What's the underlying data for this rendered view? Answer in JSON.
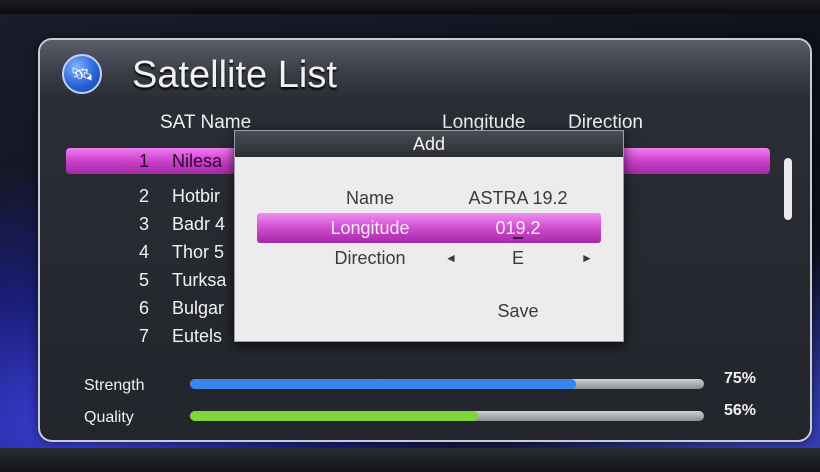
{
  "panel": {
    "title": "Satellite List",
    "icon": "satellite-icon",
    "columns": {
      "name": "SAT Name",
      "longitude": "Longitude",
      "direction": "Direction"
    }
  },
  "satellites": [
    {
      "num": "1",
      "name": "Nilesa",
      "selected": true
    },
    {
      "num": "2",
      "name": "Hotbir"
    },
    {
      "num": "3",
      "name": "Badr 4"
    },
    {
      "num": "4",
      "name": "Thor 5"
    },
    {
      "num": "5",
      "name": "Turksa"
    },
    {
      "num": "6",
      "name": "Bulgar"
    },
    {
      "num": "7",
      "name": "Eutels"
    }
  ],
  "signal": {
    "strength": {
      "label": "Strength",
      "value": 75,
      "text": "75%",
      "color": "#3a86f0"
    },
    "quality": {
      "label": "Quality",
      "value": 56,
      "text": "56%",
      "color": "#7ed63a"
    }
  },
  "dialog": {
    "title": "Add",
    "name_label": "Name",
    "name_value": "ASTRA 19.2",
    "longitude_label": "Longitude",
    "longitude_value": "019.2",
    "direction_label": "Direction",
    "direction_value": "E",
    "left_arrow": "◄",
    "right_arrow": "►",
    "save_label": "Save"
  },
  "colors": {
    "highlight": "#c83cc8",
    "panel_border": "#c9ccd6"
  }
}
